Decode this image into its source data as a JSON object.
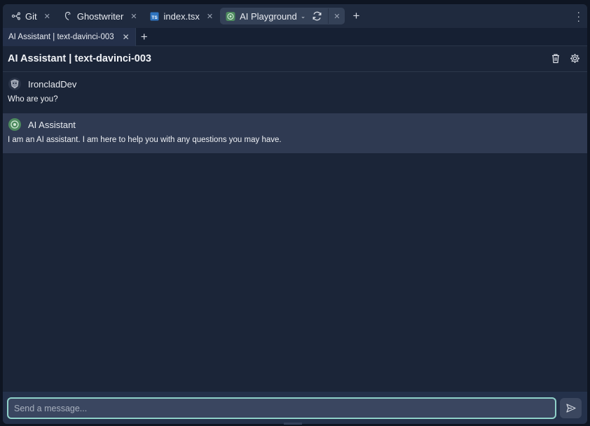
{
  "tabs": [
    {
      "label": "Git",
      "icon": "git-icon"
    },
    {
      "label": "Ghostwriter",
      "icon": "ghostwriter-icon"
    },
    {
      "label": "index.tsx",
      "icon": "typescript-file-icon"
    },
    {
      "label": "AI Playground",
      "icon": "openai-icon"
    }
  ],
  "subtab": {
    "label": "AI Assistant | text-davinci-003"
  },
  "header": {
    "title": "AI Assistant | text-davinci-003"
  },
  "messages": [
    {
      "author": "IroncladDev",
      "text": "Who are you?"
    },
    {
      "author": "AI Assistant",
      "text": "I am an AI assistant. I am here to help you with any questions you may have."
    }
  ],
  "composer": {
    "placeholder": "Send a message..."
  },
  "colors": {
    "accent": "#8fd1c9",
    "background": "#1b2538",
    "highlight": "#2f3a52"
  }
}
